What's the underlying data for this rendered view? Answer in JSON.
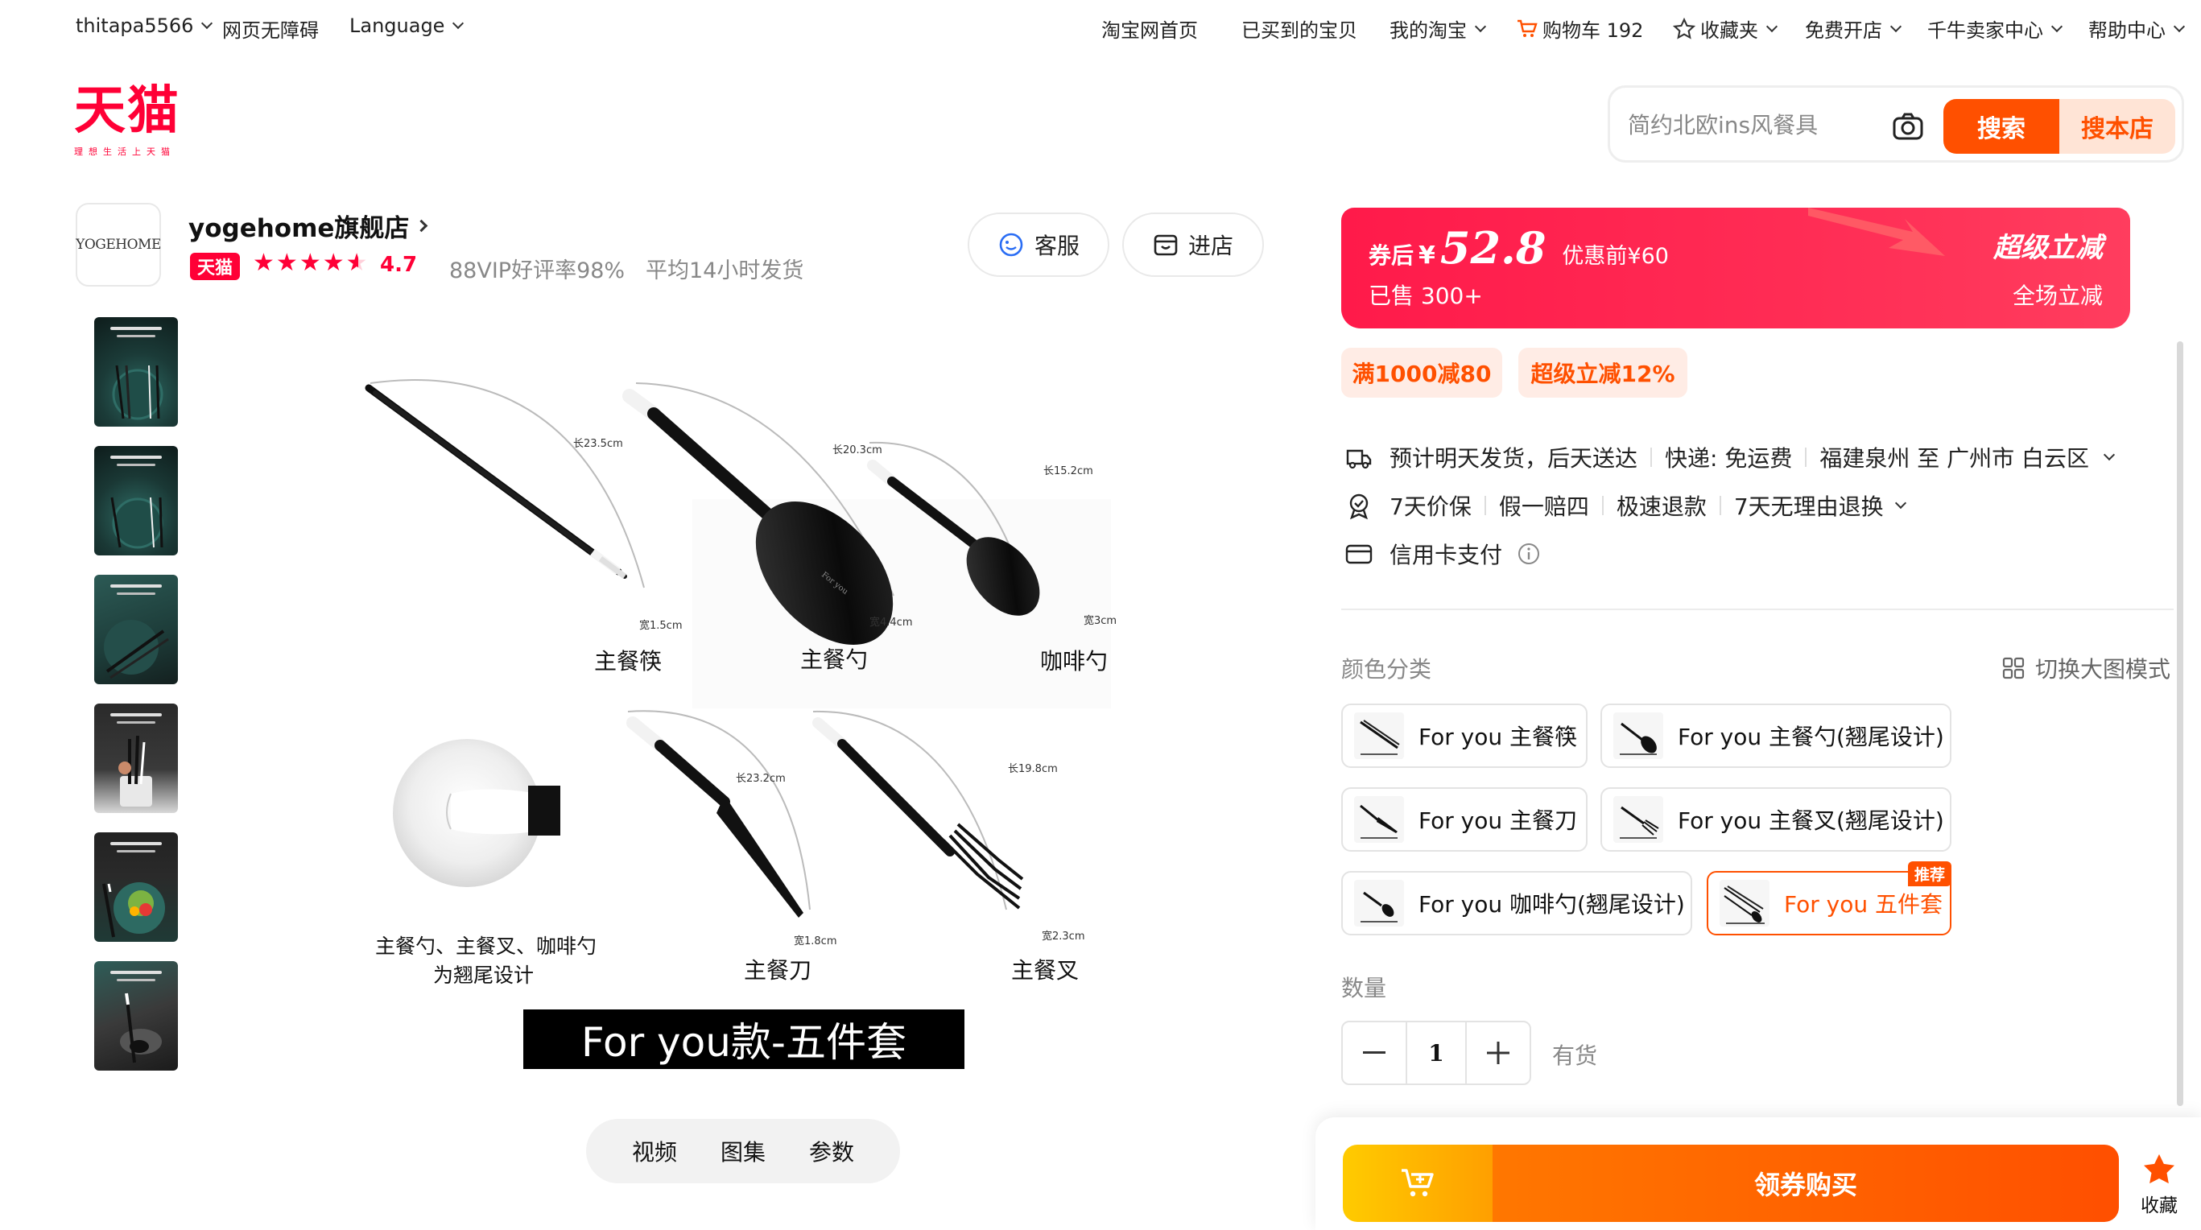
{
  "topbar": {
    "username": "thitapa5566",
    "accessibility": "网页无障碍",
    "language": "Language",
    "home": "淘宝网首页",
    "bought": "已买到的宝贝",
    "my_taobao": "我的淘宝",
    "cart": "购物车 192",
    "favorites": "收藏夹",
    "open_store": "免费开店",
    "seller_center": "千牛卖家中心",
    "help": "帮助中心"
  },
  "logo": {
    "text": "天猫",
    "tagline": "理想生活上天猫"
  },
  "search": {
    "placeholder": "简约北欧ins风餐具",
    "search_label": "搜索",
    "store_search_label": "搜本店"
  },
  "shop": {
    "logo_text": "YOGEHOME",
    "name": "yogehome旗舰店",
    "badge": "天猫",
    "rating": "4.7",
    "stars": 4.5,
    "vip_rate": "88VIP好评率98%",
    "ship_time": "平均14小时发货",
    "service_label": "客服",
    "enter_label": "进店"
  },
  "thumbnails": [
    {
      "name": "thumb-1"
    },
    {
      "name": "thumb-2"
    },
    {
      "name": "thumb-3"
    },
    {
      "name": "thumb-4"
    },
    {
      "name": "thumb-5"
    },
    {
      "name": "thumb-6"
    }
  ],
  "main_image": {
    "items": {
      "chopsticks": "主餐筷",
      "spoon": "主餐勺",
      "coffee_spoon": "咖啡勺",
      "knife": "主餐刀",
      "fork": "主餐叉"
    },
    "dims": {
      "chop_len": "长23.5cm",
      "chop_w": "宽1.5cm",
      "spoon_len": "长20.3cm",
      "spoon_w": "宽4.4cm",
      "coffee_len": "长15.2cm",
      "coffee_w": "宽3cm",
      "knife_len": "长23.2cm",
      "knife_w": "宽1.8cm",
      "fork_len": "长19.8cm",
      "fork_w": "宽2.3cm"
    },
    "note_line1": "主餐勺、主餐叉、咖啡勺",
    "note_line2": "为翘尾设计",
    "banner": "For you款-五件套"
  },
  "media_tabs": [
    "视频",
    "图集",
    "参数"
  ],
  "price": {
    "prefix": "券后",
    "currency": "¥",
    "value": "52.8",
    "original": "优惠前¥60",
    "sold": "已售 300+",
    "promo_title": "超级立减",
    "promo_sub": "全场立减"
  },
  "promo_tags": [
    "满1000减80",
    "超级立减12%"
  ],
  "delivery": {
    "ship": "预计明天发货，后天送达",
    "express": "快递: 免运费",
    "route": "福建泉州 至 广州市 白云区"
  },
  "guarantees": [
    "7天价保",
    "假一赔四",
    "极速退款",
    "7天无理由退换"
  ],
  "payment": "信用卡支付",
  "sku": {
    "label": "颜色分类",
    "switch_view": "切换大图模式",
    "options": [
      "For you 主餐筷",
      "For you 主餐勺(翘尾设计)",
      "For you 主餐刀",
      "For you 主餐叉(翘尾设计)",
      "For you 咖啡勺(翘尾设计)",
      "For you 五件套"
    ],
    "selected_index": 5,
    "recommend_badge": "推荐"
  },
  "quantity": {
    "label": "数量",
    "value": "1",
    "stock": "有货"
  },
  "buy_bar": {
    "buy_label": "领券购买",
    "fav_label": "收藏"
  },
  "colors": {
    "accent": "#ff5000",
    "tmall_red": "#ff0036",
    "price_red": "#ff2d55"
  }
}
